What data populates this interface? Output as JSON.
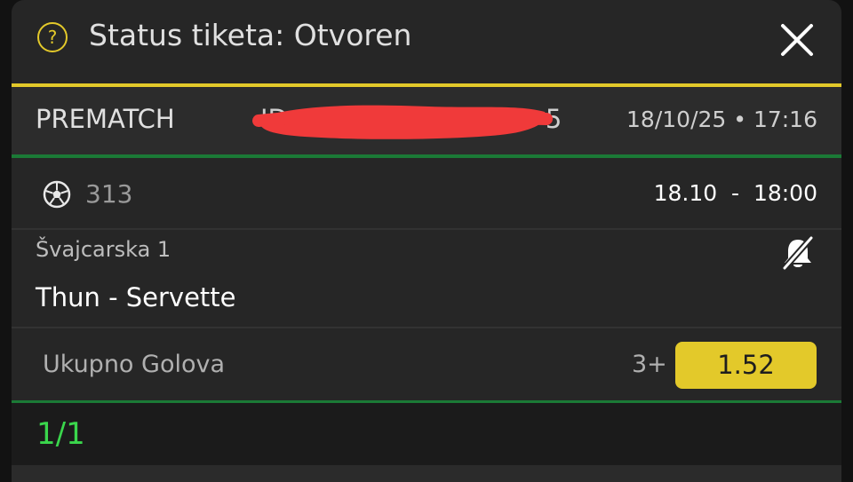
{
  "header": {
    "title": "Status tiketa: Otvoren",
    "help_icon": "help-circle-icon",
    "close_icon": "close-icon",
    "accent_color": "#e3c92a"
  },
  "ticket": {
    "type": "PREMATCH",
    "id_visible_prefix": "ID",
    "id_visible_suffix": "5",
    "date": "18/10/25 • 17:16"
  },
  "event": {
    "sport_icon": "soccer-ball-icon",
    "code": "313",
    "time": "18.10  -  18:00",
    "league": "Švajcarska 1",
    "match": "Thun - Servette",
    "notification_icon": "bell-off-icon"
  },
  "bet": {
    "market": "Ukupno Golova",
    "outcome": "3+",
    "odds": "1.52"
  },
  "footer": {
    "count": "1/1",
    "count_color": "#3ad64c"
  }
}
